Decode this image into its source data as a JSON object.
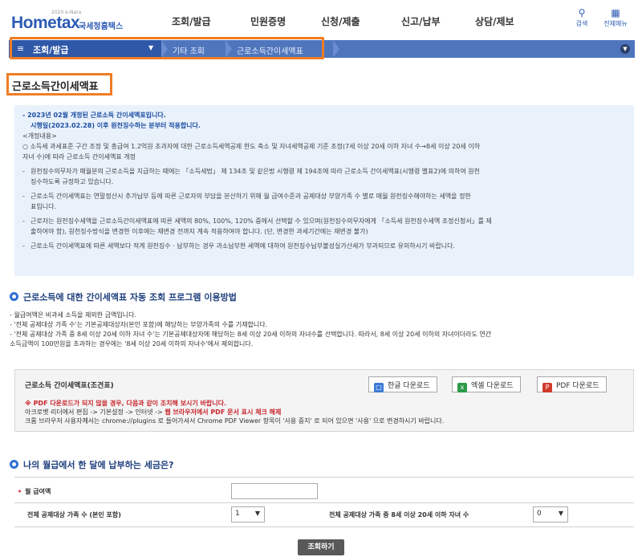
{
  "header": {
    "logo_brand": "Hometax",
    "logo_sub": "국세청홈택스",
    "logo_tiny": "2020 e-Nara",
    "nav": [
      "조회/발급",
      "민원증명",
      "신청/제출",
      "신고/납부",
      "상담/제보"
    ],
    "search_label": "검색",
    "fullmenu_label": "전체메뉴"
  },
  "breadcrumb": {
    "main": "조회/발급",
    "items": [
      "기타 조회",
      "근로소득간이세액표"
    ]
  },
  "page_title": "근로소득간이세액표",
  "info": {
    "line1": "- 2023년 02월  개정된 근로소득 간이세액표입니다.",
    "line2": "시행일(2023.02.28) 이후 원천징수하는 분부터 적용합니다.",
    "line3": "<개정내용>",
    "line4": "○ 소득세 과세표준 구간 조정 및 총급여 1.2억원 초과자에 대한 근로소득세액공제 한도 축소 및 자녀세액공제 기준 조정(7세 이상 20세 이하 자녀 수→8세 이상 20세 이하",
    "line5": "자녀 수)에 따라 근로소득 간이세액표 개정",
    "bullet1a": "원천징수의무자가 매월분의 근로소득을 지급하는 때에는 「소득세법」 제 134조 및 같은법 시행령 제 194조에 따라 근로소득 간이세액표(시행령 별표2)에 의하여 원천",
    "bullet1b": "징수하도록 규정하고 있습니다.",
    "bullet2a": "근로소득 간이세액표는 연말정산시 추가납부 등에 따른 근로자의 부담을 분산하기 위해 월 급여수준과 공제대상 부양가족 수 별로 매월 원천징수해야하는 세액을 정한",
    "bullet2b": "표입니다.",
    "bullet3a": "근로자는 원천징수세액을 근로소득간이세액표에 따른 세액의 80%, 100%, 120% 중에서 선택할 수 있으며(원천징수의무자에게 「소득세 원천징수세액 조정신청서」를 제",
    "bullet3b": "출하여야 함), 원천징수방식을 변경한 이후에는 재변경 전까지 계속 적용하여야 합니다. (단, 변경한 과세기간에는 재변경 불가)",
    "bullet4": "근로소득 간이세액표에 따른 세액보다 적게 원천징수 · 납부하는 경우 과소납부한 세액에 대하여 원천징수납부불성실가산세가 부과되므로 유의하시기 바랍니다."
  },
  "section1": {
    "title": "근로소득에 대한 간이세액표 자동 조회 프로그램 이용방법",
    "d1": "- 월급여액은   비과세 소득을 제외한 금액입니다.",
    "d2": "- '전체 공제대상 가족 수'는 기본공제대상자(본인 포함)에 해당하는 부양가족의 수를 기재합니다.",
    "d3": "- '전체 공제대상 가족 중 8세 이상 20세 이하 자녀 수'는 기본공제대상자에 해당하는 8세 이상 20세 이하의 자녀수를 선택합니다. 따라서, 8세 이상 20세 이하의 자녀이더라도 연간",
    "d4": "  소득금액이 100만원을 초과하는 경우에는 '8세 이상 20세 이하의 자녀수'에서 제외합니다."
  },
  "download": {
    "title": "근로소득 간이세액표(조견표)",
    "hwp_label": "한글 다운로드",
    "excel_label": "엑셀 다운로드",
    "pdf_label": "PDF 다운로드",
    "note1": "※ PDF 다운로드가 되지 않을 경우, 다음과 같이 조치해 보시기 바랍니다.",
    "note2a": "아크로뱃 리더에서 편집 -> 기본설정 -> 인터넷 ->  ",
    "note2b": "웹 브라우저에서 PDF 문서 표시 체크 해제",
    "note3": "크롬 브라우저 사용자께서는 chrome://plugins 로 들어가셔서 Chrome PDF Viewer 항목이 '사용 중지' 로 되어 있으면 '사용' 으로 변경하시기 바랍니다."
  },
  "section2": {
    "title": "나의 월급에서 한 달에 납부하는 세금은?"
  },
  "form": {
    "salary_label": "월 급여액",
    "salary_value": "",
    "family_label": "전체 공제대상 가족 수 (본인 포함)",
    "family_value": "1",
    "children_label": "전체 공제대상 가족 중 8세 이상 20세 이하 자녀 수",
    "children_value": "0",
    "submit_label": "조회하기"
  },
  "colors": {
    "accent_orange": "#f07d24",
    "brand_blue": "#2d5bb5",
    "crumb_blue": "#4f75bd"
  }
}
